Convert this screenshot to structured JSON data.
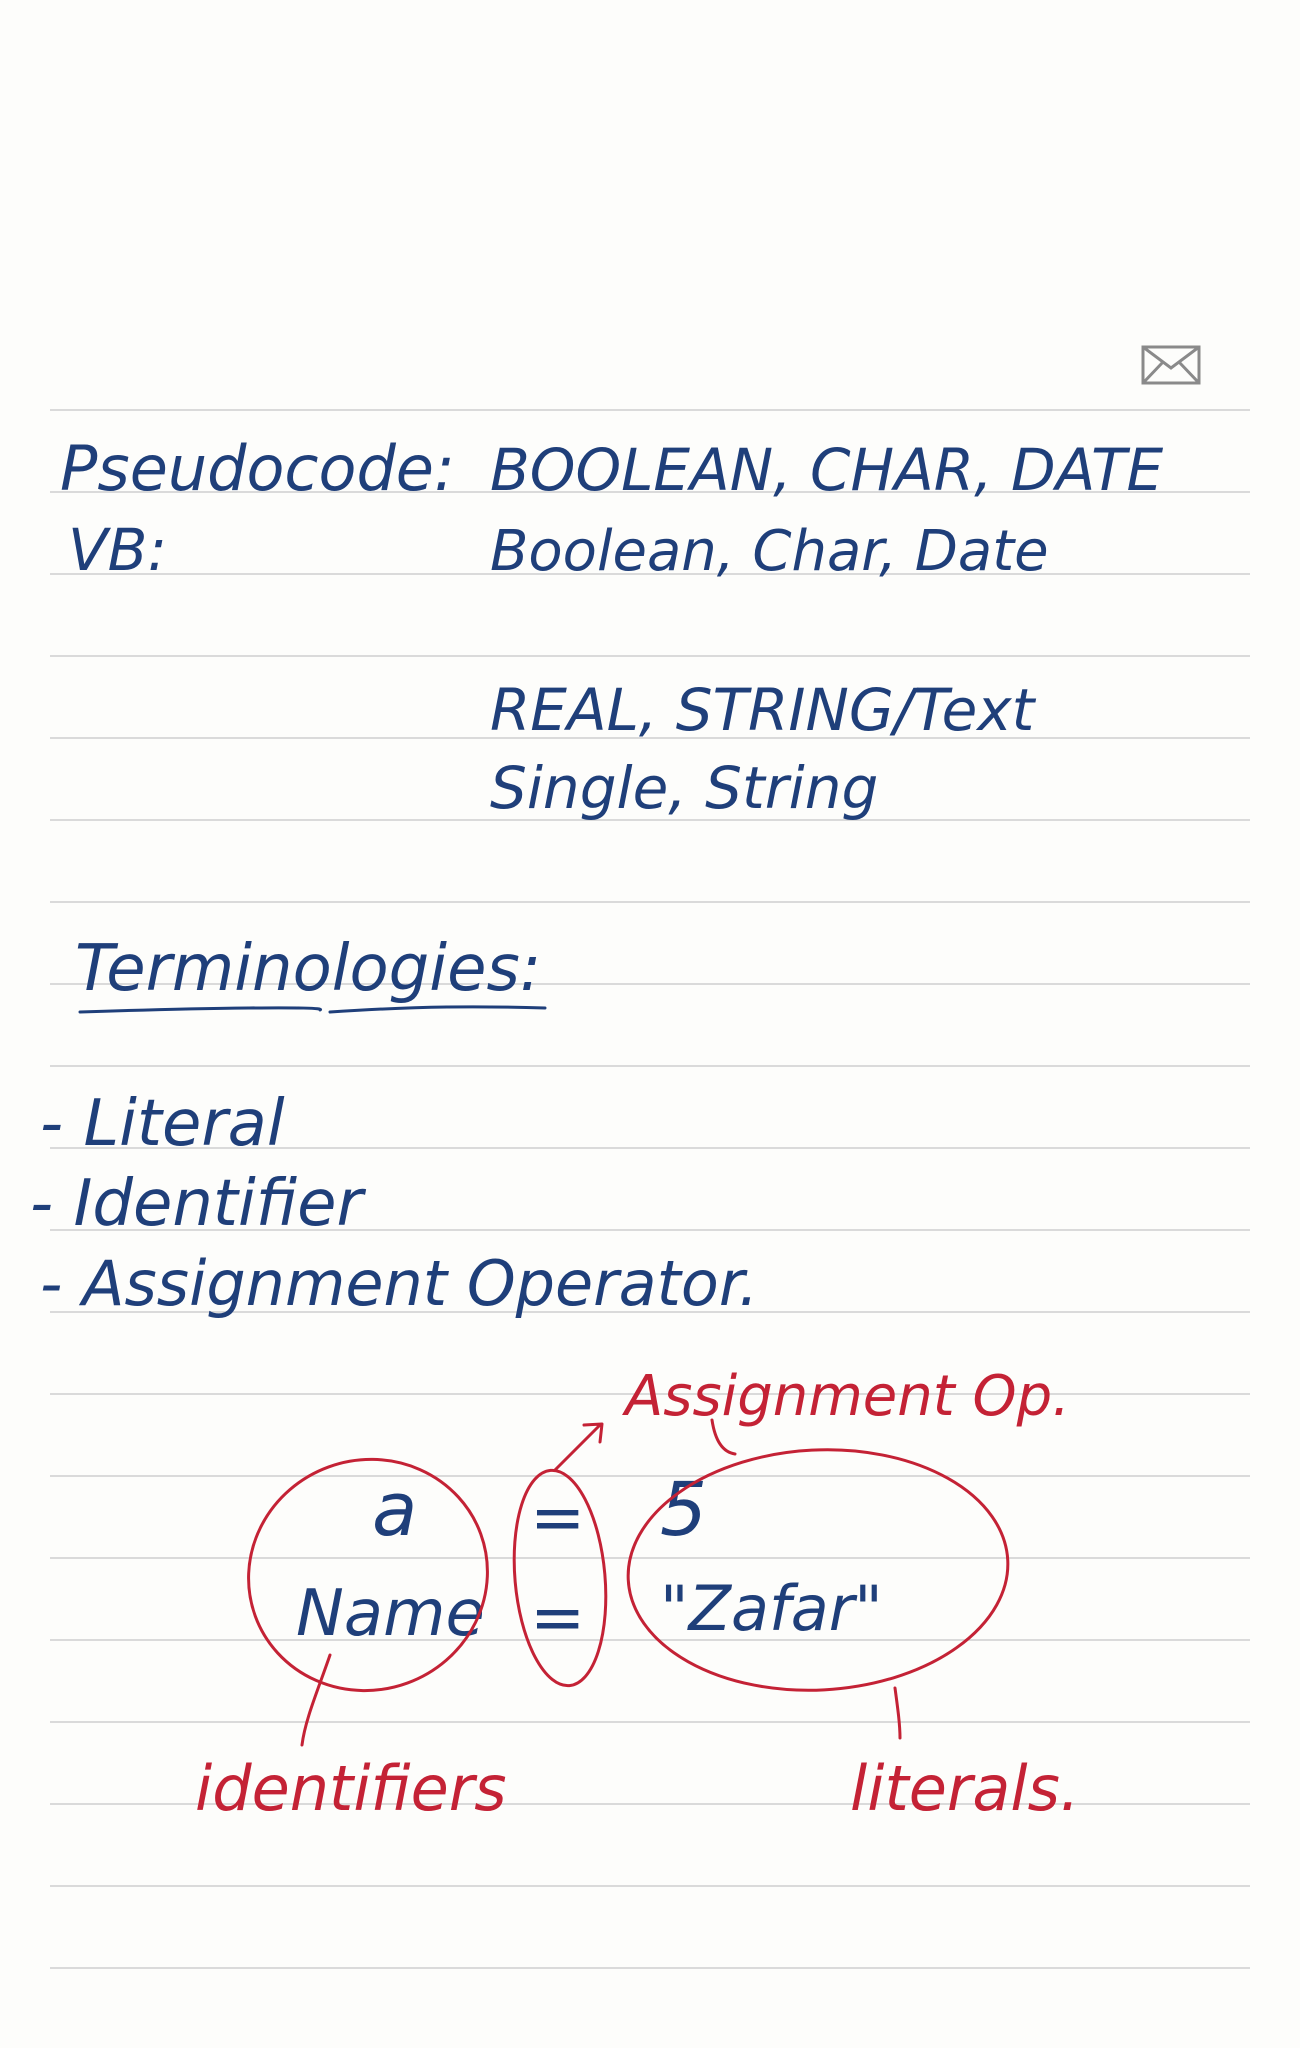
{
  "notes": {
    "types": {
      "pseudocode_label": "Pseudocode:",
      "pseudocode_types_1": "BOOLEAN, CHAR, DATE",
      "vb_label": "VB:",
      "vb_types_1": "Boolean, Char, Date",
      "pseudocode_types_2": "REAL, STRING/Text",
      "vb_types_2": "Single, String"
    },
    "terminologies": {
      "heading": "Terminologies:",
      "items": [
        "- Literal",
        "- Identifier",
        "- Assignment Operator."
      ]
    },
    "example": {
      "identifiers": [
        "a",
        "Name"
      ],
      "operators": [
        "=",
        "="
      ],
      "literals": [
        "5",
        "\"Zafar\""
      ],
      "annotation_assignment": "Assignment Op.",
      "annotation_identifiers": "identifiers",
      "annotation_literals": "literals."
    }
  },
  "colors": {
    "ink_blue": "#1f3f7a",
    "ink_red": "#c42235",
    "rule_line": "#cfcfcf",
    "paper": "#fdfdfb"
  },
  "icons": {
    "mail": "envelope-icon"
  }
}
